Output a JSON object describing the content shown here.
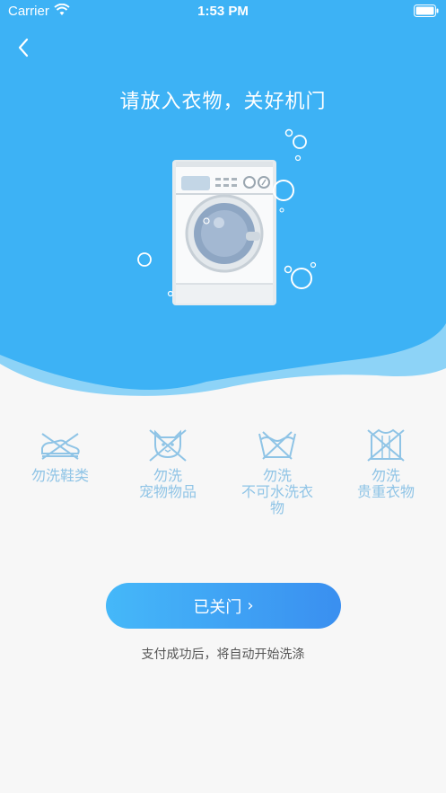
{
  "status_bar": {
    "carrier": "Carrier",
    "time": "1:53 PM"
  },
  "header": {
    "title": "请放入衣物，关好机门"
  },
  "warnings": [
    {
      "icon": "no-shoes-icon",
      "label": "勿洗鞋类"
    },
    {
      "icon": "no-pet-items-icon",
      "label": "勿洗\n宠物物品"
    },
    {
      "icon": "no-water-wash-icon",
      "label": "勿洗\n不可水洗衣\n物"
    },
    {
      "icon": "no-valuable-clothes-icon",
      "label": "勿洗\n贵重衣物"
    }
  ],
  "action": {
    "confirm_label": "已关门",
    "chevron": "›"
  },
  "hint": "支付成功后，将自动开始洗涤",
  "colors": {
    "primary": "#3db2f5",
    "icon": "#8fc4e6"
  }
}
